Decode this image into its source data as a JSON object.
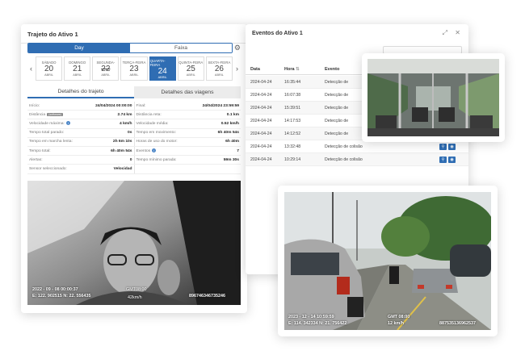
{
  "left": {
    "title": "Trajeto do Ativo 1",
    "toggle": {
      "day": "Day",
      "range": "Faixa"
    },
    "days": [
      {
        "name": "SÁBADO",
        "num": "20",
        "month": "ABRIL"
      },
      {
        "name": "DOMINGO",
        "num": "21",
        "month": "ABRIL"
      },
      {
        "name": "SEGUNDA-",
        "num": "22",
        "month": "ABRIL"
      },
      {
        "name": "TERÇA-FEIRA",
        "num": "23",
        "month": "ABRIL"
      },
      {
        "name": "QUARTA-FEIRA",
        "num": "24",
        "month": "ABRIL"
      },
      {
        "name": "QUINTA-FEIRA",
        "num": "25",
        "month": "ABRIL"
      },
      {
        "name": "SEXTA-FEIRA",
        "num": "26",
        "month": "ABRIL"
      }
    ],
    "tabs": {
      "trip": "Detalhes do trajeto",
      "travels": "Detalhes das viagens"
    },
    "details": [
      [
        {
          "l": "Início:",
          "v": "24/04/2024 00:00:00"
        },
        {
          "l": "Final:",
          "v": "24/04/2024 23:59:59"
        }
      ],
      [
        {
          "l": "Distância",
          "badge": "(software)",
          "v": "2.74 km"
        },
        {
          "l": "Distância reta:",
          "v": "0.1 km"
        }
      ],
      [
        {
          "l": "Velocidade máxima:",
          "v": "4 km/h"
        },
        {
          "l": "Velocidade média:",
          "v": "0.52 km/h"
        }
      ],
      [
        {
          "l": "Tempo total parado:",
          "v": "0s"
        },
        {
          "l": "Tempo em movimento:",
          "v": "6h 40m 54s"
        }
      ],
      [
        {
          "l": "Tempo em marcha lenta:",
          "v": "2h 6m 10s"
        },
        {
          "l": "Horas de uso do motor:",
          "v": "6h 40m"
        }
      ],
      [
        {
          "l": "Tempo total:",
          "v": "6h 40m 54s"
        },
        {
          "l": "Eventos",
          "v": "7"
        }
      ],
      [
        {
          "l": "Alertas:",
          "v": "0"
        },
        {
          "l": "Tempo mínimo parada:",
          "v": "59m 30s"
        }
      ],
      [
        {
          "l": "Sensor seleccionado:",
          "v": "Velocidad"
        },
        {
          "l": "",
          "v": ""
        }
      ]
    ],
    "cam": {
      "date": "2022 - 09 - 08  00:00:37",
      "coords": "E: 122. 902515  N: 22. 556435",
      "gmt": "GMT08:00",
      "speed": "42km/h",
      "id": "896746346735246"
    }
  },
  "events": {
    "title": "Eventos do Ativo 1",
    "headers": {
      "date": "Data",
      "time": "Hora",
      "event": "Evento"
    },
    "rows": [
      {
        "date": "2024-04-24",
        "time": "16:35:44",
        "event": "Detecção de"
      },
      {
        "date": "2024-04-24",
        "time": "16:07:38",
        "event": "Detecção de"
      },
      {
        "date": "2024-04-24",
        "time": "15:39:51",
        "event": "Detecção de"
      },
      {
        "date": "2024-04-24",
        "time": "14:17:53",
        "event": "Detecção de"
      },
      {
        "date": "2024-04-24",
        "time": "14:12:52",
        "event": "Detecção de"
      },
      {
        "date": "2024-04-24",
        "time": "13:32:48",
        "event": "Detecção de colisão"
      },
      {
        "date": "2024-04-24",
        "time": "10:29:14",
        "event": "Detecção de colisão"
      }
    ]
  },
  "road": {
    "date": "2023 - 12 - 14  10:59:59",
    "coords": "E: 114. 342334  N: 21. 756422",
    "gmt": "GMT 08:00",
    "speed": "12 km/h",
    "id": "887535136962537"
  },
  "colors": {
    "accent": "#2f6db3"
  }
}
